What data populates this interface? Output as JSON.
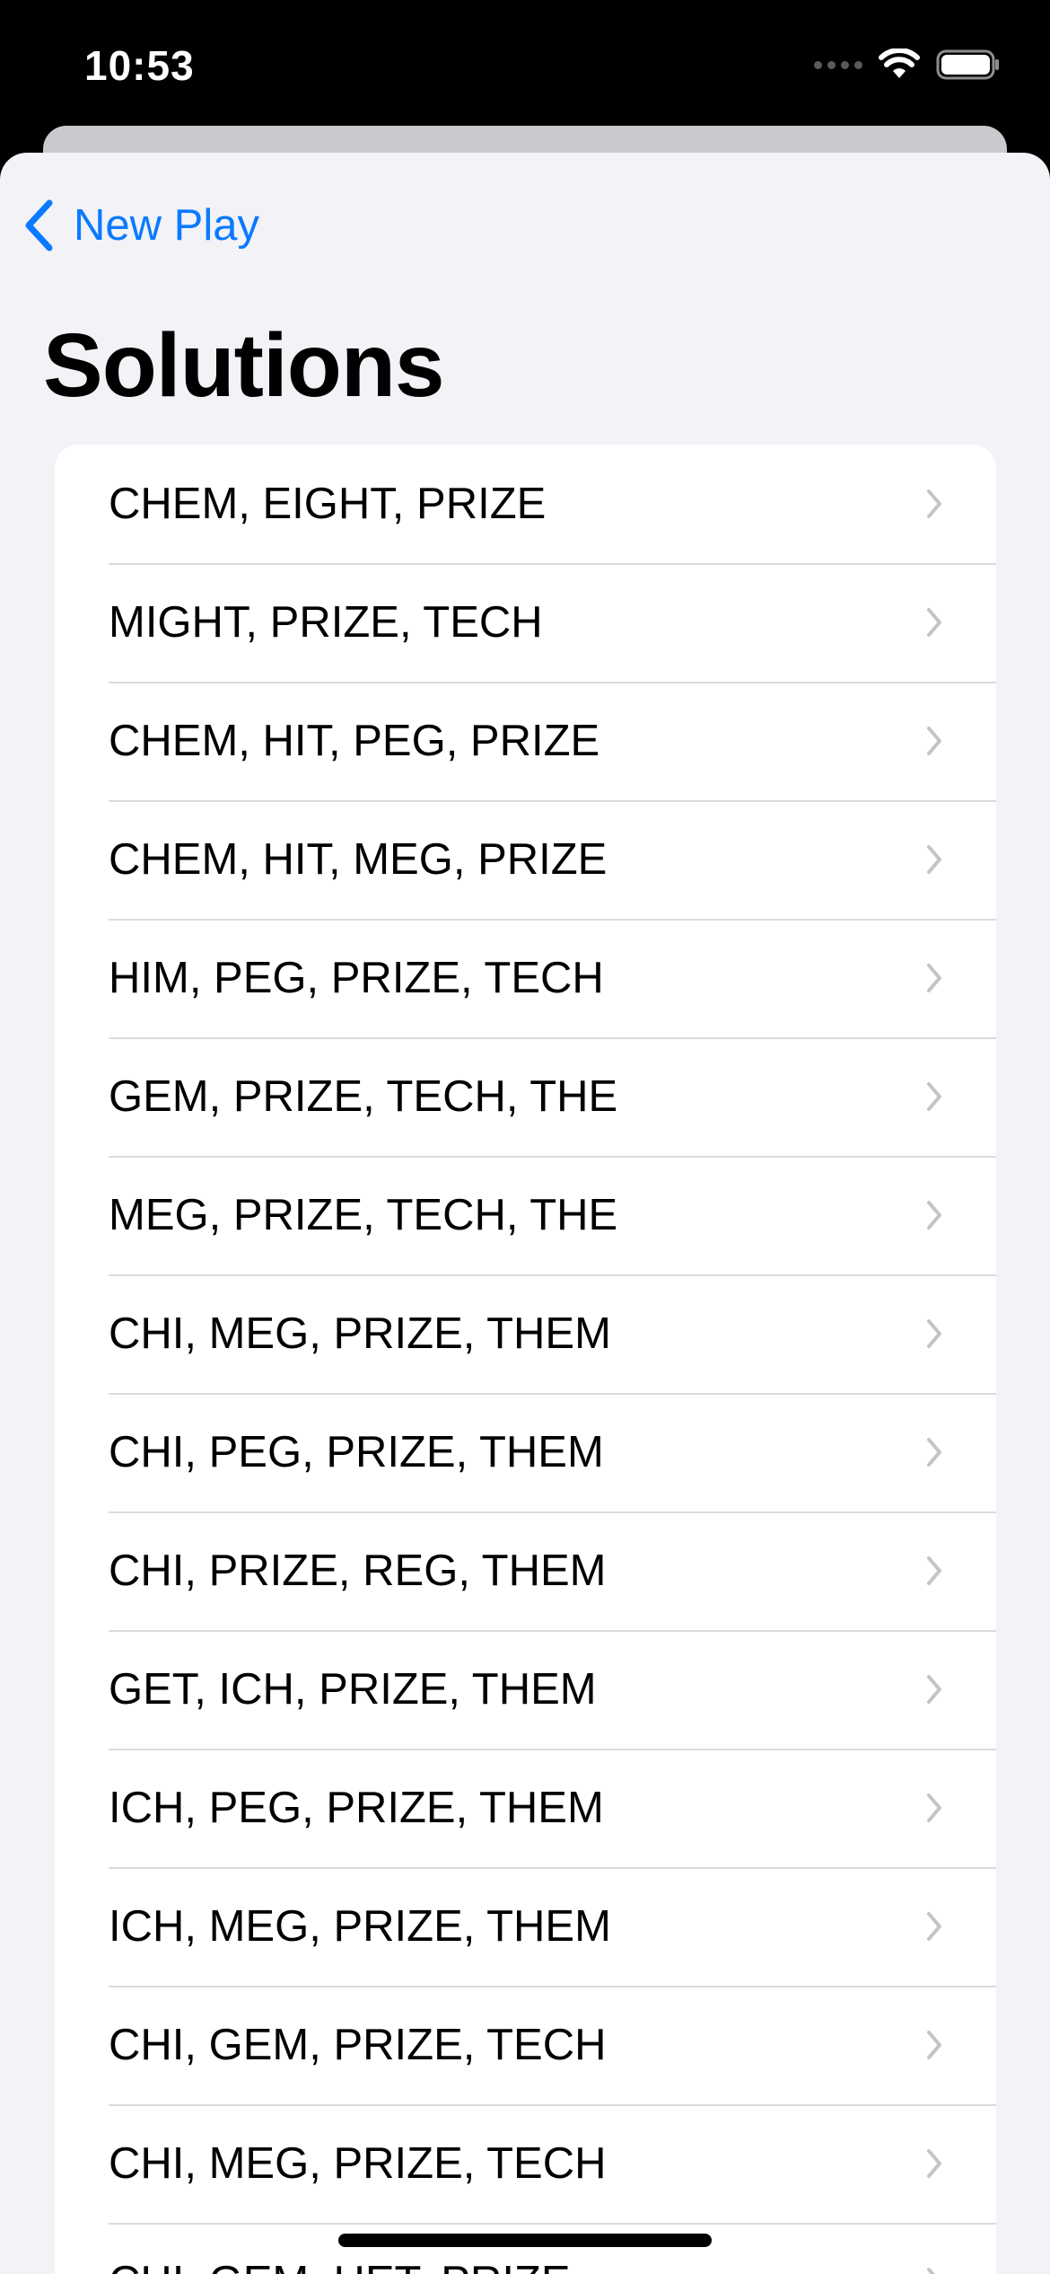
{
  "status_bar": {
    "time": "10:53"
  },
  "nav": {
    "back_label": "New Play"
  },
  "page": {
    "title": "Solutions"
  },
  "solutions": [
    "CHEM, EIGHT, PRIZE",
    "MIGHT, PRIZE, TECH",
    "CHEM, HIT, PEG, PRIZE",
    "CHEM, HIT, MEG, PRIZE",
    "HIM, PEG, PRIZE, TECH",
    "GEM, PRIZE, TECH, THE",
    "MEG, PRIZE, TECH, THE",
    "CHI, MEG, PRIZE, THEM",
    "CHI, PEG, PRIZE, THEM",
    "CHI, PRIZE, REG, THEM",
    "GET, ICH, PRIZE, THEM",
    "ICH, PEG, PRIZE, THEM",
    "ICH, MEG, PRIZE, THEM",
    "CHI, GEM, PRIZE, TECH",
    "CHI, MEG, PRIZE, TECH",
    "CHI, GEM, HET, PRIZE"
  ],
  "colors": {
    "accent": "#0a7aff",
    "background": "#f2f2f7",
    "chevron": "#c4c4c7"
  },
  "icons": {
    "back": "chevron-left-icon",
    "row": "chevron-right-icon",
    "wifi": "wifi-icon",
    "battery": "battery-icon"
  }
}
